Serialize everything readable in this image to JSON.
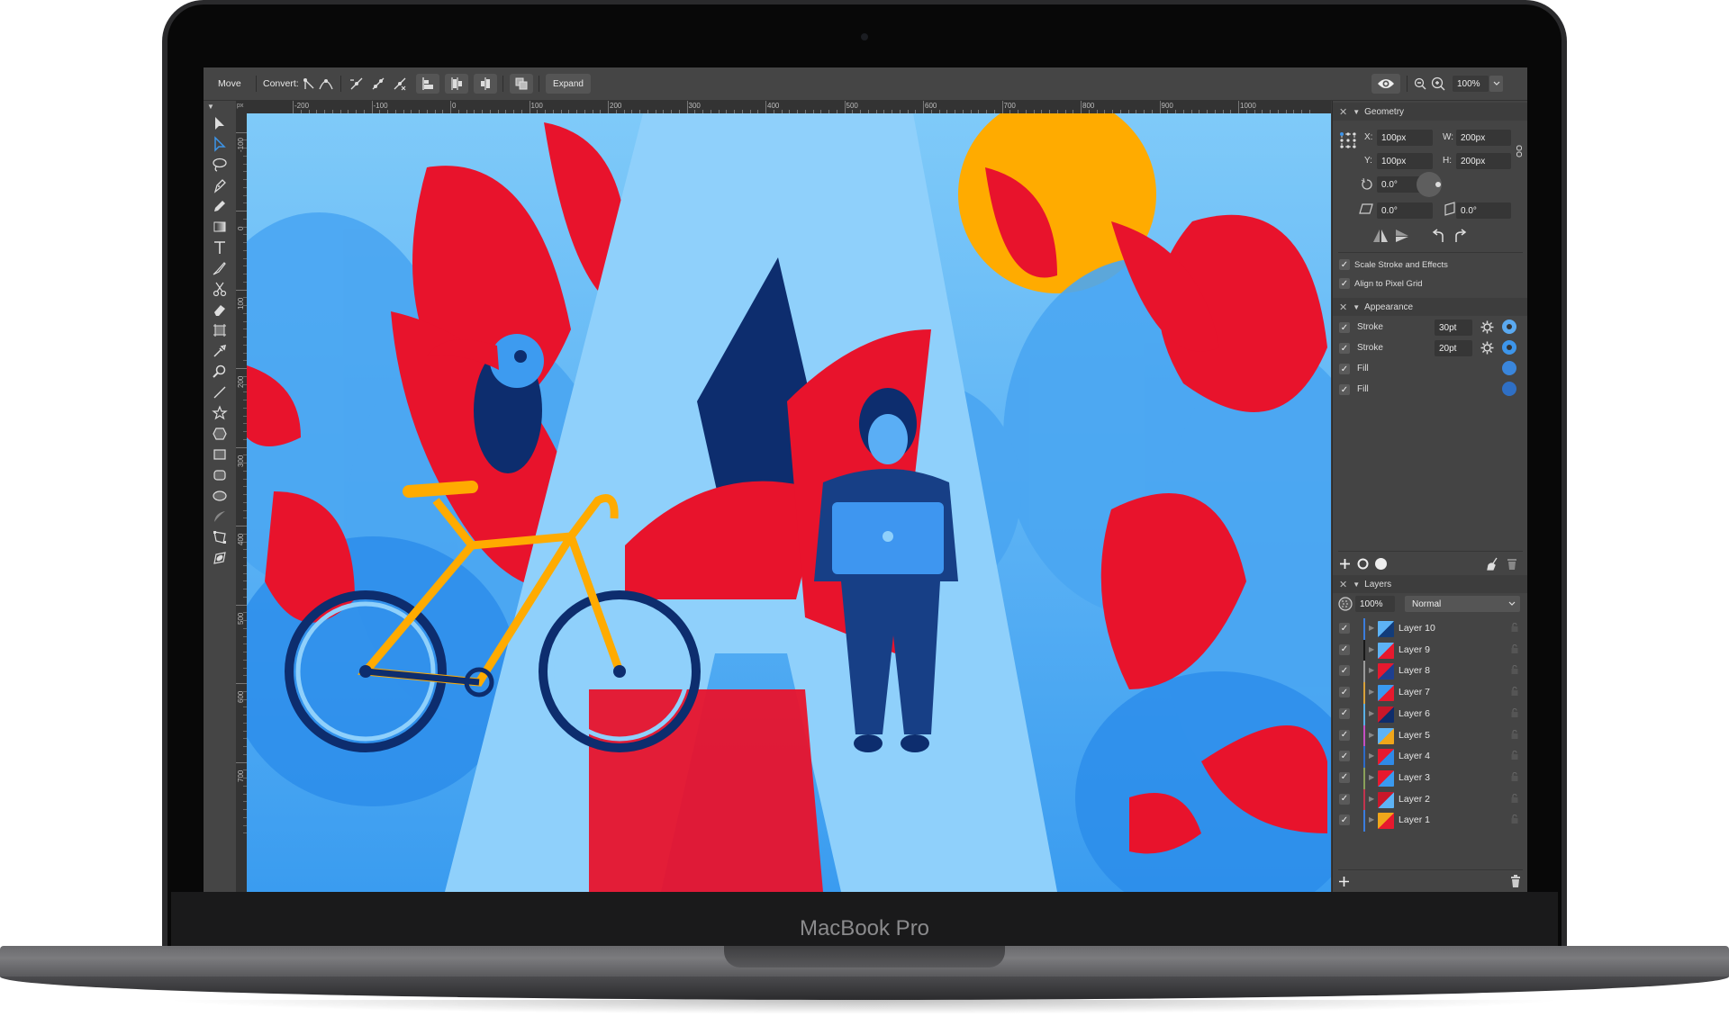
{
  "device": {
    "brand_label": "MacBook Pro"
  },
  "toolbar": {
    "move_label": "Move",
    "convert_label": "Convert:",
    "expand_label": "Expand",
    "zoom_value": "100%",
    "icons": [
      "convert-corner-icon",
      "convert-smooth-icon",
      "break-path-icon",
      "join-path-icon",
      "cut-path-icon",
      "align-bottom-left-icon",
      "distribute-horizontal-icon",
      "align-center-icon",
      "boolean-union-icon",
      "preview-eye-icon",
      "zoom-out-icon",
      "zoom-in-icon",
      "chevron-down-icon"
    ]
  },
  "ruler": {
    "unit": "px",
    "top_ticks": [
      "-200",
      "-100",
      "0",
      "100",
      "200",
      "300",
      "400",
      "500",
      "600",
      "700",
      "800",
      "900",
      "1000"
    ],
    "left_ticks": [
      "-100",
      "0",
      "100",
      "200",
      "300",
      "400",
      "500",
      "600",
      "700"
    ]
  },
  "tools": [
    "select-tool",
    "direct-select-tool",
    "lasso-tool",
    "pen-tool",
    "pencil-tool",
    "gradient-tool",
    "text-tool",
    "brush-tool",
    "scissors-tool",
    "eraser-tool",
    "artboard-tool",
    "eyedropper-tool",
    "zoom-tool",
    "line-tool",
    "star-tool",
    "polygon-tool",
    "rectangle-tool",
    "rounded-rectangle-tool",
    "ellipse-tool",
    "arc-tool",
    "transform-tool",
    "symbol-tool"
  ],
  "active_tool": "direct-select-tool",
  "geometry": {
    "title": "Geometry",
    "x_label": "X:",
    "x_value": "100px",
    "y_label": "Y:",
    "y_value": "100px",
    "w_label": "W:",
    "w_value": "200px",
    "h_label": "H:",
    "h_value": "200px",
    "rotation": "0.0°",
    "skew_h": "0.0°",
    "skew_v": "0.0°",
    "scale_stroke_label": "Scale Stroke and Effects",
    "scale_stroke_checked": true,
    "align_pixel_label": "Align to Pixel Grid",
    "align_pixel_checked": true
  },
  "appearance": {
    "title": "Appearance",
    "items": [
      {
        "label": "Stroke",
        "value": "30pt",
        "color": "#5aa9f0",
        "type": "stroke",
        "checked": true
      },
      {
        "label": "Stroke",
        "value": "20pt",
        "color": "#3d95ea",
        "type": "stroke",
        "checked": true
      },
      {
        "label": "Fill",
        "value": "",
        "color": "#3a86dc",
        "type": "fill",
        "checked": true
      },
      {
        "label": "Fill",
        "value": "",
        "color": "#2f6fc4",
        "type": "fill",
        "checked": true
      }
    ]
  },
  "layers": {
    "title": "Layers",
    "opacity": "100%",
    "blend_mode": "Normal",
    "items": [
      {
        "name": "Layer 10",
        "color": "#3b7ddd",
        "thumb": [
          "#5db3f5",
          "#123c7a"
        ],
        "checked": true
      },
      {
        "name": "Layer 9",
        "color": "#1a1a1a",
        "thumb": [
          "#5db3f5",
          "#e6192e"
        ],
        "checked": true
      },
      {
        "name": "Layer 8",
        "color": "#9a9a9a",
        "thumb": [
          "#e6192e",
          "#1e3f8f"
        ],
        "checked": true
      },
      {
        "name": "Layer 7",
        "color": "#d9a13a",
        "thumb": [
          "#3a9af0",
          "#e6192e"
        ],
        "checked": true
      },
      {
        "name": "Layer 6",
        "color": "#5ab0e6",
        "thumb": [
          "#c9172a",
          "#0f2d6b"
        ],
        "checked": true
      },
      {
        "name": "Layer 5",
        "color": "#c44fc4",
        "thumb": [
          "#5db3f5",
          "#f0a61a"
        ],
        "checked": true
      },
      {
        "name": "Layer 4",
        "color": "#2d6ac8",
        "thumb": [
          "#e6192e",
          "#2f8ae8"
        ],
        "checked": true
      },
      {
        "name": "Layer 3",
        "color": "#8aa05a",
        "thumb": [
          "#e6192e",
          "#3a9af0"
        ],
        "checked": true
      },
      {
        "name": "Layer 2",
        "color": "#c2344e",
        "thumb": [
          "#c9172a",
          "#5db3f5"
        ],
        "checked": true
      },
      {
        "name": "Layer 1",
        "color": "#3b7ddd",
        "thumb": [
          "#f0a61a",
          "#e6192e"
        ],
        "checked": true
      }
    ]
  },
  "artwork": {
    "subject": "Illustration of letter A with foliage, toucan, bicycle and person with laptop"
  }
}
